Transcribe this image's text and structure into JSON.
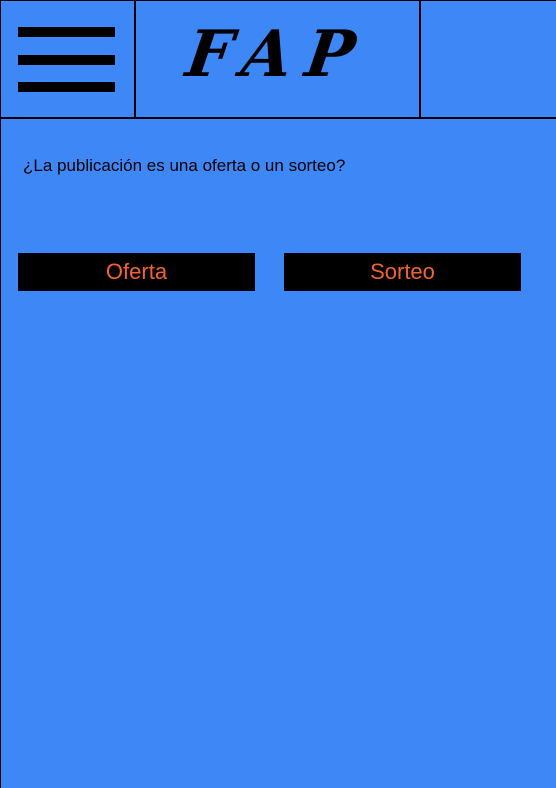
{
  "header": {
    "menu_icon": "hamburger-icon",
    "logo_text": "FAP"
  },
  "main": {
    "question": "¿La publicación es una oferta o un sorteo?",
    "options": [
      {
        "label": "Oferta"
      },
      {
        "label": "Sorteo"
      }
    ]
  },
  "colors": {
    "background": "#3e87f6",
    "button_bg": "#000000",
    "button_text": "#f2622e",
    "text": "#000000"
  }
}
